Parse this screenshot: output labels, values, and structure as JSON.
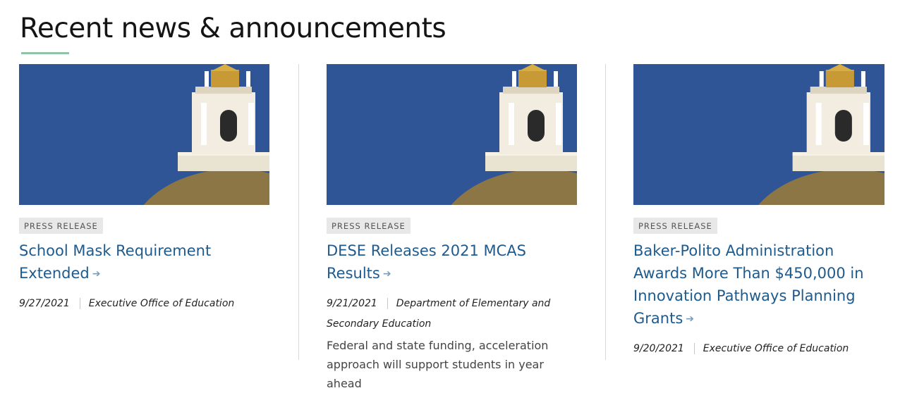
{
  "section": {
    "title": "Recent news & announcements"
  },
  "cards": [
    {
      "tag": "PRESS RELEASE",
      "title": "School Mask Requirement Extended",
      "date": "9/27/2021",
      "source": "Executive Office of Education",
      "summary": ""
    },
    {
      "tag": "PRESS RELEASE",
      "title": "DESE Releases 2021 MCAS Results",
      "date": "9/21/2021",
      "source": "Department of Elementary and Secondary Education",
      "summary": "Federal and state funding, acceleration approach will support students in year ahead"
    },
    {
      "tag": "PRESS RELEASE",
      "title": "Baker-Polito Administration Awards More Than $450,000 in Innovation Pathways Planning Grants",
      "date": "9/20/2021",
      "source": "Executive Office of Education",
      "summary": ""
    }
  ],
  "icons": {
    "title_arrow": "arrow-right-icon",
    "image": "state-house-dome-image"
  },
  "colors": {
    "link": "#1f5a8c",
    "accent_underline": "#8cc4a5",
    "sky": "#2f5597",
    "tag_bg": "#e8e8e8"
  }
}
